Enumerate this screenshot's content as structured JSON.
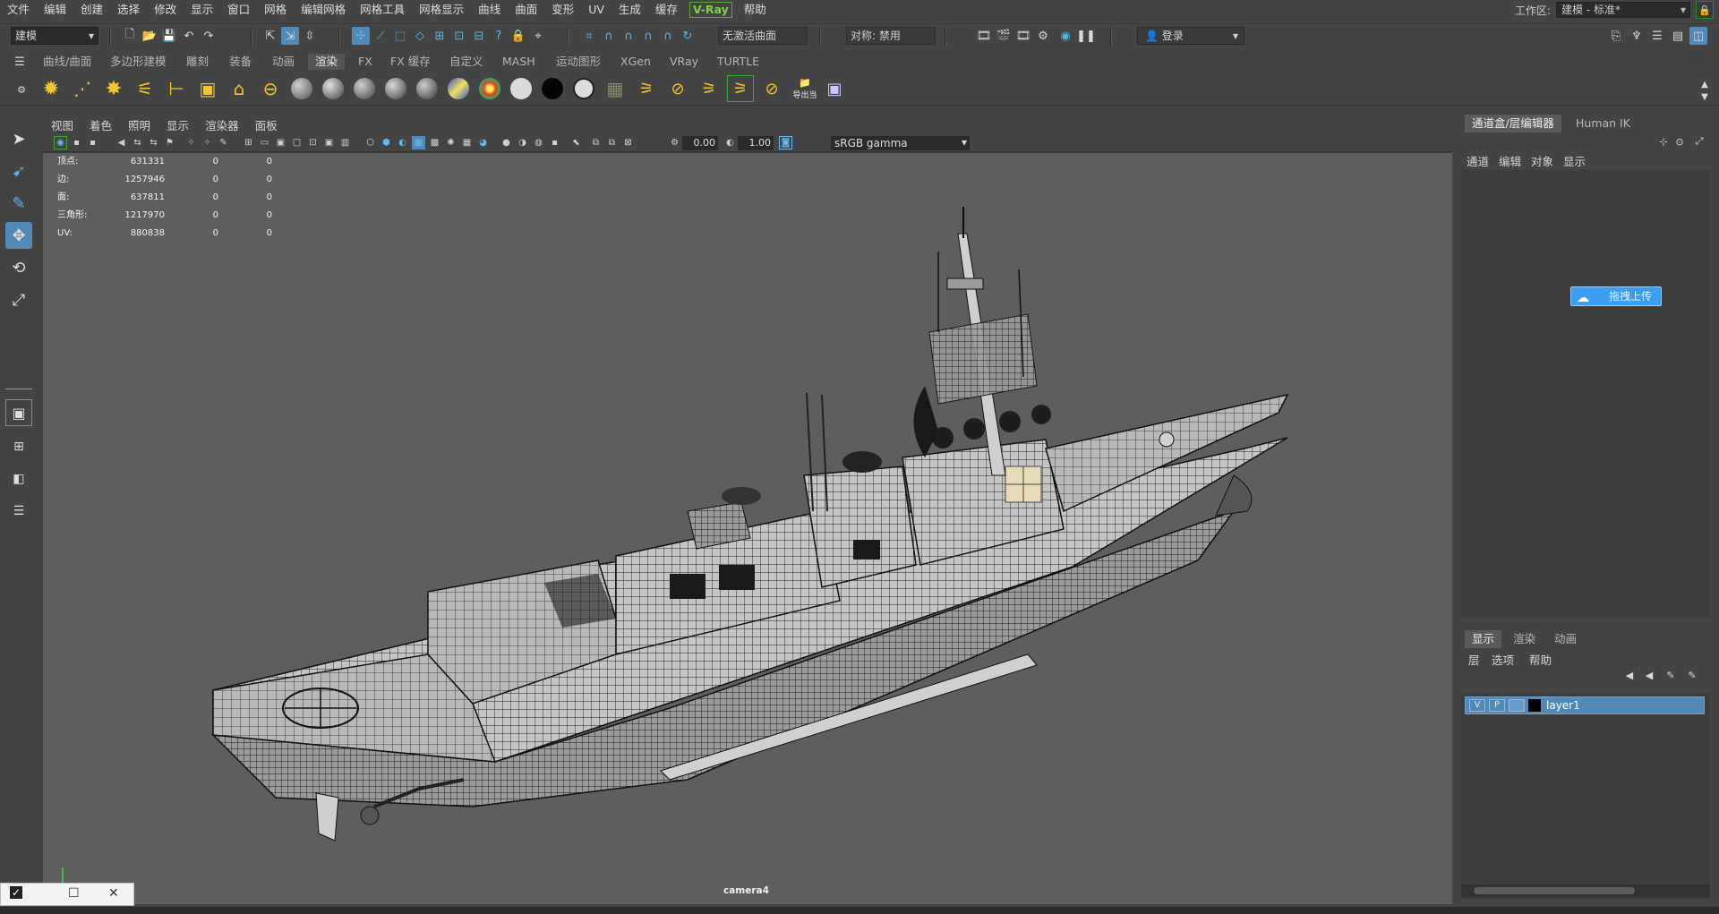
{
  "menubar": {
    "items": [
      "文件",
      "编辑",
      "创建",
      "选择",
      "修改",
      "显示",
      "窗口",
      "网格",
      "编辑网格",
      "网格工具",
      "网格显示",
      "曲线",
      "曲面",
      "变形",
      "UV",
      "生成",
      "缓存",
      "V-Ray",
      "帮助"
    ],
    "workspace_label": "工作区:",
    "workspace_value": "建模 - 标准*"
  },
  "statusline": {
    "mode": "建模",
    "live_surface": "无激活曲面",
    "symmetry": "对称: 禁用",
    "login": "登录"
  },
  "shelf": {
    "tabs": [
      "曲线/曲面",
      "多边形建模",
      "雕刻",
      "装备",
      "动画",
      "渲染",
      "FX",
      "FX 缓存",
      "自定义",
      "MASH",
      "运动图形",
      "XGen",
      "VRay",
      "TURTLE"
    ],
    "active_tab": "渲染",
    "export_label": "导出当"
  },
  "panel": {
    "menu": [
      "视图",
      "着色",
      "照明",
      "显示",
      "渲染器",
      "面板"
    ],
    "exposure": "0.00",
    "gamma": "1.00",
    "color_space": "sRGB gamma"
  },
  "hud": {
    "rows": [
      {
        "label": "顶点:",
        "v1": "631331",
        "v2": "0",
        "v3": "0"
      },
      {
        "label": "边:",
        "v1": "1257946",
        "v2": "0",
        "v3": "0"
      },
      {
        "label": "面:",
        "v1": "637811",
        "v2": "0",
        "v3": "0"
      },
      {
        "label": "三角形:",
        "v1": "1217970",
        "v2": "0",
        "v3": "0"
      },
      {
        "label": "UV:",
        "v1": "880838",
        "v2": "0",
        "v3": "0"
      }
    ]
  },
  "viewport": {
    "camera": "camera4"
  },
  "right_panel": {
    "tabs": [
      "通道盒/层编辑器",
      "Human IK"
    ],
    "menu": [
      "通道",
      "编辑",
      "对象",
      "显示"
    ],
    "upload_button": "拖拽上传",
    "layer_tabs": [
      "显示",
      "渲染",
      "动画"
    ],
    "layer_menu": [
      "层",
      "选项",
      "帮助"
    ],
    "layer": {
      "visible": "V",
      "playback": "P",
      "name": "layer1"
    }
  },
  "colors": {
    "accent": "#5289b6",
    "vray_green": "#7ad34a",
    "upload_blue": "#3b9ef3"
  }
}
